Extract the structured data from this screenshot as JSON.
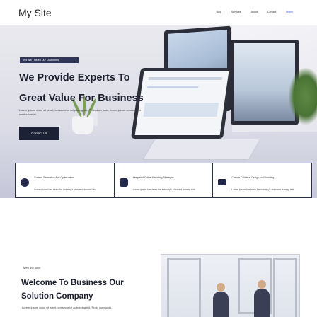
{
  "header": {
    "logo": "My Site",
    "nav": [
      {
        "label": "Blog",
        "active": false
      },
      {
        "label": "Services",
        "active": false
      },
      {
        "label": "About",
        "active": false
      },
      {
        "label": "Contact",
        "active": false
      },
      {
        "label": "Home",
        "active": true
      }
    ]
  },
  "hero": {
    "badge": "We Are Trusted Our Customers",
    "title_line1": "We Provide Experts To",
    "title_line2": "Great Value For Business",
    "text": "Lorem ipsum dolor sit amet, consectetur adipiscing elit. Proin dum justo, lorem ipsum consectetur vestibulum et.",
    "cta_label": "Contact Us"
  },
  "features": [
    {
      "icon": "bomb-icon",
      "title": "Content Generation And Optimization",
      "text": "Lorem ipsum has been the industry's standard dummy text"
    },
    {
      "icon": "globe-icon",
      "title": "Integrated Online Marketing Strategies",
      "text": "Lorem ipsum has been the industry's standard dummy text"
    },
    {
      "icon": "stack-icon",
      "title": "Custom Collateral Design And Branding",
      "text": "Lorem ipsum has been the industry's standard dummy text"
    }
  ],
  "about": {
    "eyebrow": "WHO WE ARE",
    "title_line1": "Welcome To Business Our",
    "title_line2": "Solution Company",
    "text": "Lorem ipsum dolor sit amet, consectetur adipiscing elit. Proin dum justo."
  },
  "colors": {
    "accent": "#3b5bdb",
    "navy": "#1d2136"
  }
}
